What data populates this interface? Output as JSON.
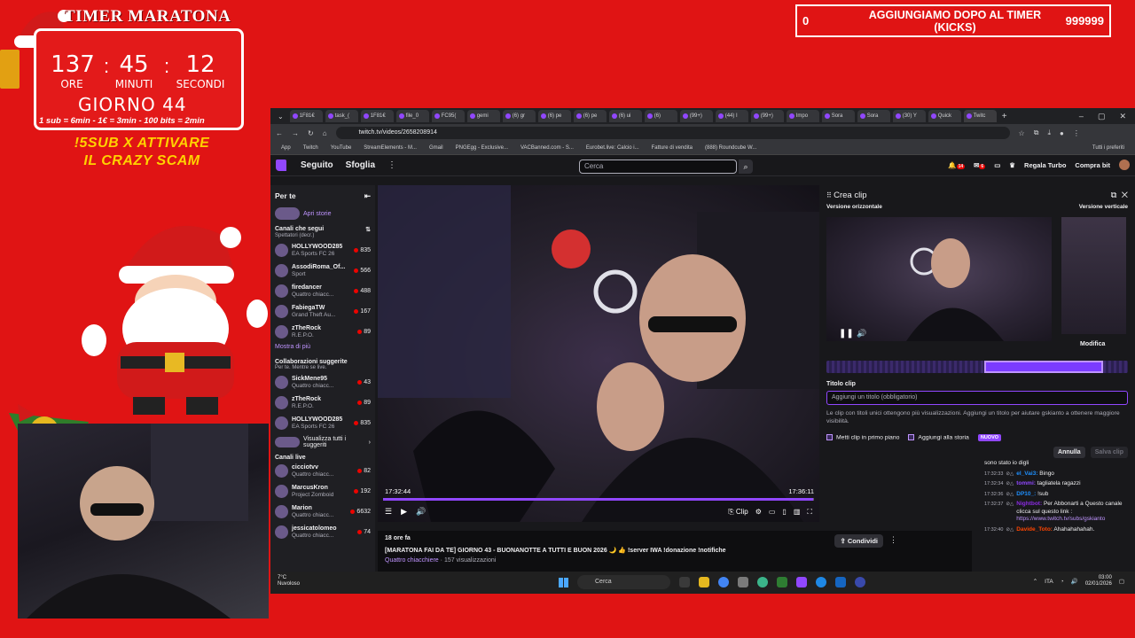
{
  "timer": {
    "title": "TIMER MARATONA",
    "hours": "137",
    "minutes": "45",
    "seconds": "12",
    "hours_label": "ORE",
    "minutes_label": "MINUTI",
    "seconds_label": "SECONDI",
    "day": "GIORNO 44",
    "rates": "1 sub = 6min - 1€ = 3min - 100 bits = 2min"
  },
  "promo_text": "!5SUB X ATTIVARE IL CRAZY SCAM",
  "goal_banner": {
    "left_value": "0",
    "text": "AGGIUNGIAMO DOPO AL TIMER (KICKS)",
    "right_value": "999999"
  },
  "browser": {
    "tabs": [
      "1F81€",
      "task_(",
      "1F81€",
      "file_0",
      "FC95(",
      "gemi",
      "(6) gr",
      "(6) pe",
      "(6) pe",
      "(6) ui",
      "(6)",
      "(99+)",
      "(44) I",
      "(99+)",
      "Impo",
      "Sora",
      "Sora",
      "(30) Y",
      "Quick",
      "Twitc"
    ],
    "url": "twitch.tv/videos/2658208914",
    "bookmarks": [
      "App",
      "Twitch",
      "YouTube",
      "StreamElements - M...",
      "Gmail",
      "PNGEgg - Exclusive...",
      "VACBanned.com - S...",
      "Eurobet.live: Calcio i...",
      "Fatture di vendita",
      "(888) Roundcube W...",
      "Tutti i preferiti"
    ]
  },
  "twitch": {
    "nav_following": "Seguito",
    "nav_browse": "Sfoglia",
    "search_placeholder": "Cerca",
    "notif_count": "14",
    "whisper_count": "6",
    "turbo_label": "Regala Turbo",
    "bits_label": "Compra bit"
  },
  "sidebar": {
    "title": "Per te",
    "stories_label": "Apri storie",
    "followed_title": "Canali che segui",
    "followed_sub": "Spettatori (decr.)",
    "followed": [
      {
        "name": "HOLLYWOOD285",
        "game": "EA Sports FC 26",
        "viewers": "835"
      },
      {
        "name": "AssodiRoma_Of...",
        "game": "Sport",
        "viewers": "566"
      },
      {
        "name": "firedancer",
        "game": "Quattro chiacc...",
        "viewers": "488"
      },
      {
        "name": "FabiegaTW",
        "game": "Grand Theft Au...",
        "viewers": "167"
      },
      {
        "name": "zTheRock",
        "game": "R.E.P.O.",
        "viewers": "89"
      }
    ],
    "show_more": "Mostra di più",
    "collab_title": "Collaborazioni suggerite",
    "collab_sub": "Per te. Mentre se live.",
    "collabs": [
      {
        "name": "SickMene95",
        "game": "Quattro chiacc...",
        "viewers": "43"
      },
      {
        "name": "zTheRock",
        "game": "R.E.P.O.",
        "viewers": "89"
      },
      {
        "name": "HOLLYWOOD285",
        "game": "EA Sports FC 26",
        "viewers": "835"
      }
    ],
    "view_all": "Visualizza tutti i suggeriti",
    "live_title": "Canali live",
    "live": [
      {
        "name": "cicciotvv",
        "game": "Quattro chiacc...",
        "viewers": "82"
      },
      {
        "name": "MarcusKron",
        "game": "Project Zomboid",
        "viewers": "192"
      },
      {
        "name": "Marion",
        "game": "Quattro chiacc...",
        "viewers": "6632"
      },
      {
        "name": "jessicatolomeo",
        "game": "Quattro chiacc...",
        "viewers": "74"
      }
    ]
  },
  "video": {
    "current_time": "17:32:44",
    "duration": "17:36:11",
    "progress": 0.997,
    "clip_label": "Clip"
  },
  "info": {
    "posted": "18 ore fa",
    "title": "[MARATONA FAI DA TE] GIORNO 43 - BUONANOTTE A TUTTI E BUON 2026 🌙 👍 !server IWA !donazione !notifiche",
    "category": "Quattro chiacchiere",
    "views": "157 visualizzazioni",
    "share_label": "Condividi"
  },
  "clip_panel": {
    "title": "Crea clip",
    "horizontal_label": "Versione orizzontale",
    "vertical_label": "Versione verticale",
    "edit_label": "Modifica",
    "title_label": "Titolo clip",
    "title_placeholder": "Aggiungi un titolo (obbligatorio)",
    "help": "Le clip con titoli unici ottengono più visualizzazioni. Aggiungi un titolo per aiutare gskianto a ottenere maggiore visibilità.",
    "feature_label": "Metti clip in primo piano",
    "story_label": "Aggiungi alla storia",
    "new_badge": "NUOVO",
    "cancel": "Annulla",
    "save": "Salva clip"
  },
  "chat": [
    {
      "time": "",
      "user": "",
      "text": "sono stato io digli",
      "color": "#efeff1"
    },
    {
      "time": "17:32:33",
      "user": "el_Vai3:",
      "text": "Bingo",
      "color": "#1e90ff"
    },
    {
      "time": "17:32:34",
      "user": "tommi:",
      "text": "tagliatela ragazzi",
      "color": "#9147ff"
    },
    {
      "time": "17:32:36",
      "user": "DP10_:",
      "text": "!sub",
      "color": "#1e90ff"
    },
    {
      "time": "17:32:37",
      "user": "Nightbot:",
      "text": "Per Abbonarti a Questo canale clicca sul questo link :",
      "link": "https://www.twitch.tv/subs/gskianto",
      "color": "#8a2be2"
    },
    {
      "time": "17:32:40",
      "user": "Davide_Toto:",
      "text": "Ahahahahahah.",
      "color": "#ff4500"
    }
  ],
  "taskbar": {
    "temp": "7°C",
    "weather": "Nuvoloso",
    "search": "Cerca",
    "lang": "ITA",
    "time": "03:00",
    "date": "02/01/2026"
  },
  "colors": {
    "background": "#e01414",
    "twitch_purple": "#9147ff",
    "timer_yellow": "#ffd200"
  }
}
